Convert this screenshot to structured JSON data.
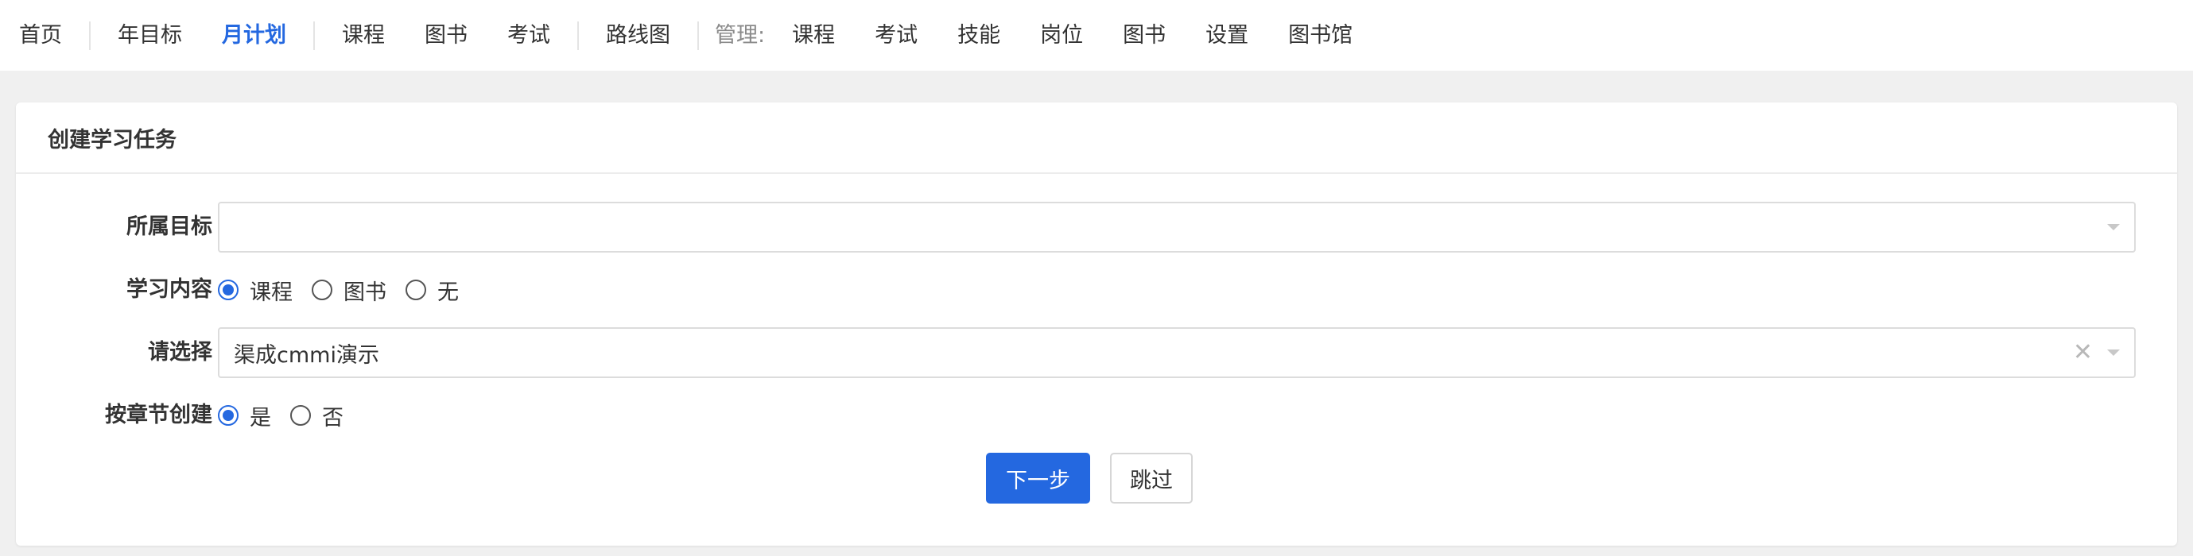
{
  "nav": {
    "home": "首页",
    "year_goal": "年目标",
    "month_plan": "月计划",
    "course": "课程",
    "book": "图书",
    "exam": "考试",
    "roadmap": "路线图",
    "manage_label": "管理:",
    "manage_course": "课程",
    "manage_exam": "考试",
    "manage_skill": "技能",
    "manage_position": "岗位",
    "manage_book": "图书",
    "manage_settings": "设置",
    "manage_library": "图书馆"
  },
  "card": {
    "title": "创建学习任务"
  },
  "form": {
    "goal_label": "所属目标",
    "goal_value": "",
    "content_label": "学习内容",
    "content_options": [
      "课程",
      "图书",
      "无"
    ],
    "content_selected": "课程",
    "select_label": "请选择",
    "select_value": "渠成cmmi演示",
    "chapter_label": "按章节创建",
    "chapter_options": [
      "是",
      "否"
    ],
    "chapter_selected": "是"
  },
  "buttons": {
    "next": "下一步",
    "skip": "跳过"
  },
  "colors": {
    "accent": "#2468e0",
    "background": "#f0f0f0"
  }
}
